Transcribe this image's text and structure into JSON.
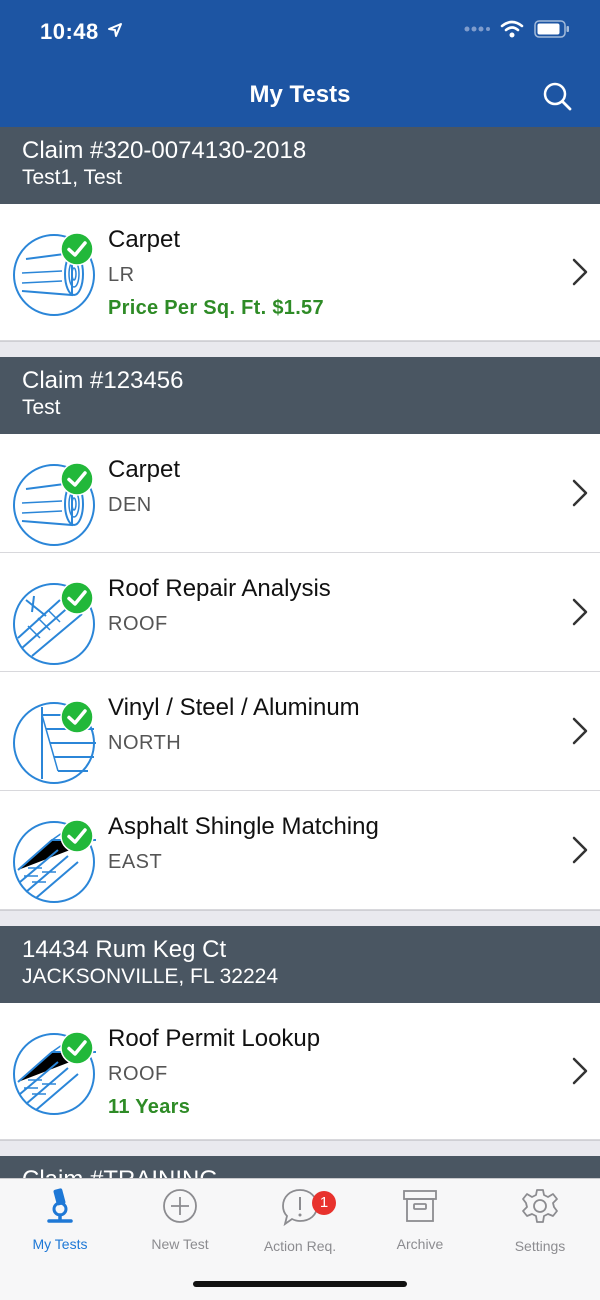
{
  "status": {
    "time": "10:48"
  },
  "header": {
    "title": "My Tests"
  },
  "groups": [
    {
      "title": "Claim #320-0074130-2018",
      "subtitle": "Test1, Test",
      "items": [
        {
          "name": "Carpet",
          "location": "LR",
          "extra": "Price Per Sq. Ft. $1.57",
          "icon": "carpet-icon"
        }
      ]
    },
    {
      "title": "Claim #123456",
      "subtitle": "Test",
      "items": [
        {
          "name": "Carpet",
          "location": "DEN",
          "icon": "carpet-icon"
        },
        {
          "name": "Roof Repair Analysis",
          "location": "ROOF",
          "icon": "roof-repair-icon"
        },
        {
          "name": "Vinyl / Steel / Aluminum",
          "location": "NORTH",
          "icon": "siding-icon"
        },
        {
          "name": "Asphalt Shingle Matching",
          "location": "EAST",
          "icon": "shingle-icon"
        }
      ]
    },
    {
      "title": "14434 Rum Keg Ct",
      "subtitle": "JACKSONVILLE, FL 32224",
      "items": [
        {
          "name": "Roof Permit Lookup",
          "location": "ROOF",
          "extra": "11 Years",
          "icon": "shingle-icon"
        }
      ]
    },
    {
      "title": "Claim #TRAINING",
      "subtitle": ""
    }
  ],
  "tabs": [
    {
      "label": "My Tests",
      "icon": "microscope-icon",
      "active": true
    },
    {
      "label": "New Test",
      "icon": "plus-circle-icon"
    },
    {
      "label": "Action Req.",
      "icon": "alert-bubble-icon",
      "badge": "1"
    },
    {
      "label": "Archive",
      "icon": "archive-box-icon"
    },
    {
      "label": "Settings",
      "icon": "gear-icon"
    }
  ],
  "colors": {
    "header": "#1d55a3",
    "group_header": "#4a5662",
    "success": "#2e8b26",
    "accent": "#1e78d6",
    "badge": "#e8322d"
  }
}
